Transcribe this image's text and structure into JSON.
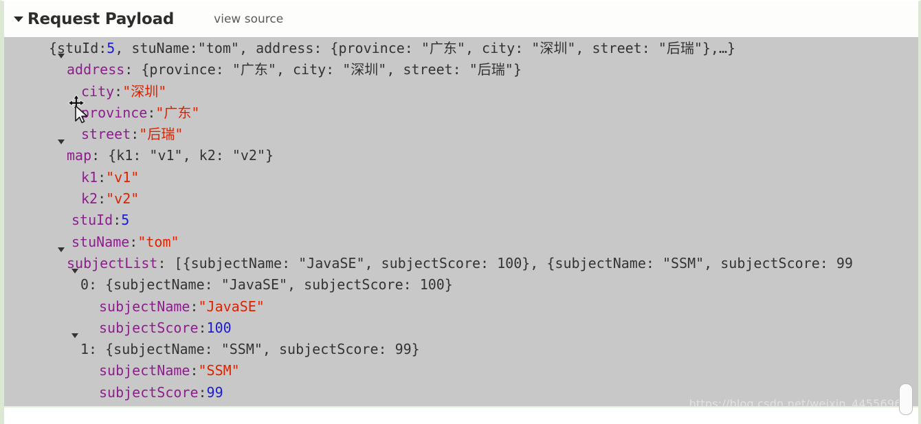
{
  "header": {
    "caret_icon": "triangle-down-icon",
    "title": "Request Payload",
    "view_source_link": "view source"
  },
  "colors": {
    "background": "#c8c8c8",
    "header_background": "#fdfefb",
    "key": "#8d1d8d",
    "string": "#dd2200",
    "number": "#1b1bd6",
    "plain": "#333333",
    "border_green": "#dce8d4"
  },
  "cursor": {
    "icon": "move-resize-cursor-icon"
  },
  "watermark": {
    "text": "https://blog.csdn.net/weixin_44556968"
  },
  "scrollbar": {
    "thumb_label": "vertical-scrollbar-thumb"
  },
  "payload": {
    "rows": [
      {
        "id": "root",
        "indent": 0,
        "caret": true,
        "segments": [
          {
            "t": "{stuId: ",
            "c": "plain"
          },
          {
            "t": "5",
            "c": "num"
          },
          {
            "t": ", stuName: ",
            "c": "plain"
          },
          {
            "t": "\"tom\"",
            "c": "plain"
          },
          {
            "t": ", address: {province: \"广东\", city: \"深圳\", street: \"后瑞\"},…}",
            "c": "plain"
          }
        ]
      },
      {
        "id": "address",
        "indent": 1,
        "caret": true,
        "segments": [
          {
            "t": "address",
            "c": "k"
          },
          {
            "t": ": {province: \"广东\", city: \"深圳\", street: \"后瑞\"}",
            "c": "plain"
          }
        ]
      },
      {
        "id": "address-city",
        "indent": 3,
        "caret": false,
        "segments": [
          {
            "t": "city",
            "c": "k"
          },
          {
            "t": ": ",
            "c": "plain"
          },
          {
            "t": "\"深圳\"",
            "c": "str"
          }
        ]
      },
      {
        "id": "address-province",
        "indent": 3,
        "caret": false,
        "segments": [
          {
            "t": "province",
            "c": "k"
          },
          {
            "t": ": ",
            "c": "plain"
          },
          {
            "t": "\"广东\"",
            "c": "str"
          }
        ]
      },
      {
        "id": "address-street",
        "indent": 3,
        "caret": false,
        "segments": [
          {
            "t": "street",
            "c": "k"
          },
          {
            "t": ": ",
            "c": "plain"
          },
          {
            "t": "\"后瑞\"",
            "c": "str"
          }
        ]
      },
      {
        "id": "map",
        "indent": 1,
        "caret": true,
        "segments": [
          {
            "t": "map",
            "c": "k"
          },
          {
            "t": ": {k1: \"v1\", k2: \"v2\"}",
            "c": "plain"
          }
        ]
      },
      {
        "id": "map-k1",
        "indent": 3,
        "caret": false,
        "segments": [
          {
            "t": "k1",
            "c": "k"
          },
          {
            "t": ": ",
            "c": "plain"
          },
          {
            "t": "\"v1\"",
            "c": "str"
          }
        ]
      },
      {
        "id": "map-k2",
        "indent": 3,
        "caret": false,
        "segments": [
          {
            "t": "k2",
            "c": "k"
          },
          {
            "t": ": ",
            "c": "plain"
          },
          {
            "t": "\"v2\"",
            "c": "str"
          }
        ]
      },
      {
        "id": "stuId",
        "indent": 2,
        "caret": false,
        "segments": [
          {
            "t": "stuId",
            "c": "k"
          },
          {
            "t": ": ",
            "c": "plain"
          },
          {
            "t": "5",
            "c": "num"
          }
        ]
      },
      {
        "id": "stuName",
        "indent": 2,
        "caret": false,
        "segments": [
          {
            "t": "stuName",
            "c": "k"
          },
          {
            "t": ": ",
            "c": "plain"
          },
          {
            "t": "\"tom\"",
            "c": "str"
          }
        ]
      },
      {
        "id": "subjectList",
        "indent": 1,
        "caret": true,
        "segments": [
          {
            "t": "subjectList",
            "c": "k"
          },
          {
            "t": ": [{subjectName: \"JavaSE\", subjectScore: 100}, {subjectName: \"SSM\", subjectScore: 99",
            "c": "plain"
          }
        ]
      },
      {
        "id": "subjectList-0",
        "indent": 2,
        "caret": true,
        "segments": [
          {
            "t": "0",
            "c": "idx"
          },
          {
            "t": ": {subjectName: \"JavaSE\", subjectScore: 100}",
            "c": "plain"
          }
        ]
      },
      {
        "id": "subjectList-0-name",
        "indent": 4,
        "caret": false,
        "segments": [
          {
            "t": "subjectName",
            "c": "k"
          },
          {
            "t": ": ",
            "c": "plain"
          },
          {
            "t": "\"JavaSE\"",
            "c": "str"
          }
        ]
      },
      {
        "id": "subjectList-0-score",
        "indent": 4,
        "caret": false,
        "segments": [
          {
            "t": "subjectScore",
            "c": "k"
          },
          {
            "t": ": ",
            "c": "plain"
          },
          {
            "t": "100",
            "c": "num"
          }
        ]
      },
      {
        "id": "subjectList-1",
        "indent": 2,
        "caret": true,
        "segments": [
          {
            "t": "1",
            "c": "idx"
          },
          {
            "t": ": {subjectName: \"SSM\", subjectScore: 99}",
            "c": "plain"
          }
        ]
      },
      {
        "id": "subjectList-1-name",
        "indent": 4,
        "caret": false,
        "segments": [
          {
            "t": "subjectName",
            "c": "k"
          },
          {
            "t": ": ",
            "c": "plain"
          },
          {
            "t": "\"SSM\"",
            "c": "str"
          }
        ]
      },
      {
        "id": "subjectList-1-score",
        "indent": 4,
        "caret": false,
        "segments": [
          {
            "t": "subjectScore",
            "c": "k"
          },
          {
            "t": ": ",
            "c": "plain"
          },
          {
            "t": "99",
            "c": "num"
          }
        ]
      }
    ]
  }
}
